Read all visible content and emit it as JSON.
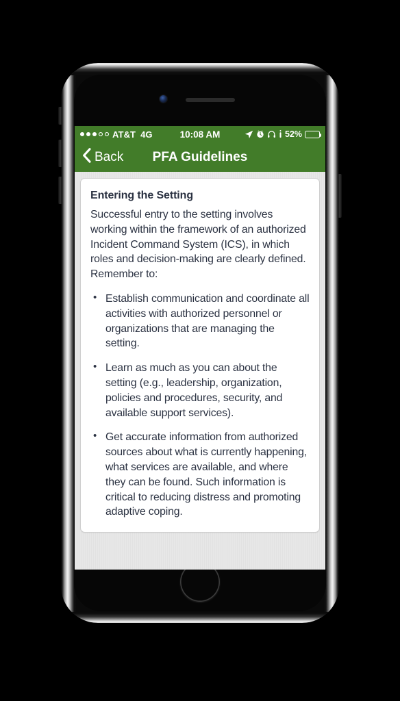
{
  "status_bar": {
    "signal_dots_filled": 3,
    "signal_dots_total": 5,
    "carrier": "AT&T",
    "network": "4G",
    "time": "10:08 AM",
    "icons": [
      "location-arrow-icon",
      "alarm-clock-icon",
      "headphones-icon",
      "do-not-disturb-icon"
    ],
    "battery_percent": "52%",
    "battery_level": 52,
    "background_color": "#427C29",
    "foreground_color": "#ffffff"
  },
  "nav_bar": {
    "back_label": "Back",
    "title": "PFA Guidelines",
    "background_color": "#427C29"
  },
  "content": {
    "heading": "Entering the Setting",
    "intro": "Successful entry to the setting involves working within the framework of an authorized Incident Command System (ICS), in which roles and decision-making are clearly defined. Remember to:",
    "bullets": [
      "Establish communication and coordinate all activities with authorized personnel or organizations that are managing the setting.",
      "Learn as much as you can about the setting (e.g., leadership, organization, policies and procedures, security, and available support services).",
      "Get accurate information from authorized sources about what is currently happening, what services are available, and where they can be found. Such information is critical to reducing distress and promoting adaptive coping."
    ],
    "text_color": "#2b3242",
    "card_background": "#ffffff",
    "page_background": "#e7e7e7"
  },
  "device": {
    "name": "iphone-frame",
    "components": [
      "front-camera",
      "earpiece-speaker",
      "home-button",
      "volume-up-button",
      "volume-down-button",
      "mute-switch",
      "power-button"
    ]
  }
}
